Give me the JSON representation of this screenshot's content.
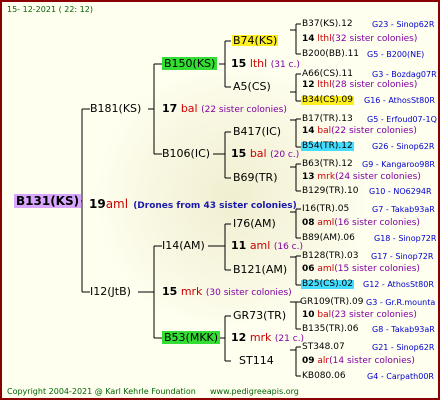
{
  "date": "15- 12-2021 ( 22: 12)",
  "root": "B131(KS)",
  "drone_line": {
    "num": "19",
    "abbr": "aml",
    "count": "(Drones from 43 sister colonies)"
  },
  "sire": {
    "label": "B181(KS)",
    "num": "17",
    "abbr": "bal",
    "count": "(22 sister colonies)"
  },
  "dam": {
    "label": "I12(JtB)",
    "num": "15",
    "abbr": "mrk",
    "count": "(30 sister colonies)"
  },
  "ss": {
    "label": "B150(KS)",
    "num": "15",
    "abbr": "lthl",
    "count": "(31 c.)"
  },
  "sd": {
    "label": "B106(IC)",
    "num": "15",
    "abbr": "bal",
    "count": "(20 c.)"
  },
  "ds": {
    "label": "I14(AM)",
    "num": "11",
    "abbr": "aml",
    "count": "(16 c.)"
  },
  "dd": {
    "label": "B53(MKK)",
    "num": "12",
    "abbr": "mrk",
    "count": "(21 c.)"
  },
  "g3": [
    {
      "label": "B74(KS)",
      "num": "14",
      "abbr": "lthl",
      "count": "(32 sister colonies)"
    },
    {
      "label": "A5(CS)",
      "num": "12",
      "abbr": "lthl",
      "count": "(28 sister colonies)"
    },
    {
      "label": "B417(IC)",
      "num": "14",
      "abbr": "bal",
      "count": "(22 sister colonies)"
    },
    {
      "label": "B69(TR)",
      "num": "13",
      "abbr": "mrk",
      "count": "(24 sister colonies)"
    },
    {
      "label": "I76(AM)",
      "num": "08",
      "abbr": "aml",
      "count": "(16 sister colonies)"
    },
    {
      "label": "B121(AM)",
      "num": "06",
      "abbr": "aml",
      "count": "(15 sister colonies)"
    },
    {
      "label": "GR73(TR)",
      "num": "10",
      "abbr": "bal",
      "count": "(23 sister colonies)"
    },
    {
      "label": "ST114",
      "num": "09",
      "abbr": "alr",
      "count": "(14 sister colonies)"
    }
  ],
  "g4": [
    {
      "label": "B37(KS).12",
      "tail": "G23 - Sinop62R"
    },
    {
      "label": "B200(BB).11",
      "tail": "G5 - B200(NE)"
    },
    {
      "label": "A66(CS).11",
      "tail": "G3 - Bozdag07R"
    },
    {
      "label": "B34(CS).09",
      "tail": "G16 - AthosSt80R"
    },
    {
      "label": "B17(TR).13",
      "tail": "G5 - Erfoud07-1Q"
    },
    {
      "label": "B54(TR).12",
      "tail": "G26 - Sinop62R"
    },
    {
      "label": "B63(TR).12",
      "tail": "G9 - Kangaroo98R"
    },
    {
      "label": "B129(TR).10",
      "tail": "G10 - NO6294R"
    },
    {
      "label": "I16(TR).05",
      "tail": "G7 - Takab93aR"
    },
    {
      "label": "B89(AM).06",
      "tail": "G18 - Sinop72R"
    },
    {
      "label": "B128(TR).03",
      "tail": "G17 - Sinop72R"
    },
    {
      "label": "B25(CS).02",
      "tail": "G12 - AthosSt80R"
    },
    {
      "label": "GR109(TR).09",
      "tail": "G3 - Gr.R.mounta"
    },
    {
      "label": "B135(TR).06",
      "tail": "G8 - Takab93aR"
    },
    {
      "label": "ST348.07",
      "tail": "G21 - Sinop62R"
    },
    {
      "label": "KB080.06",
      "tail": "G4 - Carpath00R"
    }
  ],
  "footer": {
    "copyright": "Copyright 2004-2021 @ Karl Kehrle Foundation",
    "url": "www.pedigreeapis.org"
  },
  "colors": {
    "border": "#8b0000",
    "root_bg": "#d9a6ff",
    "green_bg": "#33dd33",
    "yellow_bg": "#ffee22",
    "cyan_bg": "#44ddff",
    "code": "#0000cc"
  }
}
